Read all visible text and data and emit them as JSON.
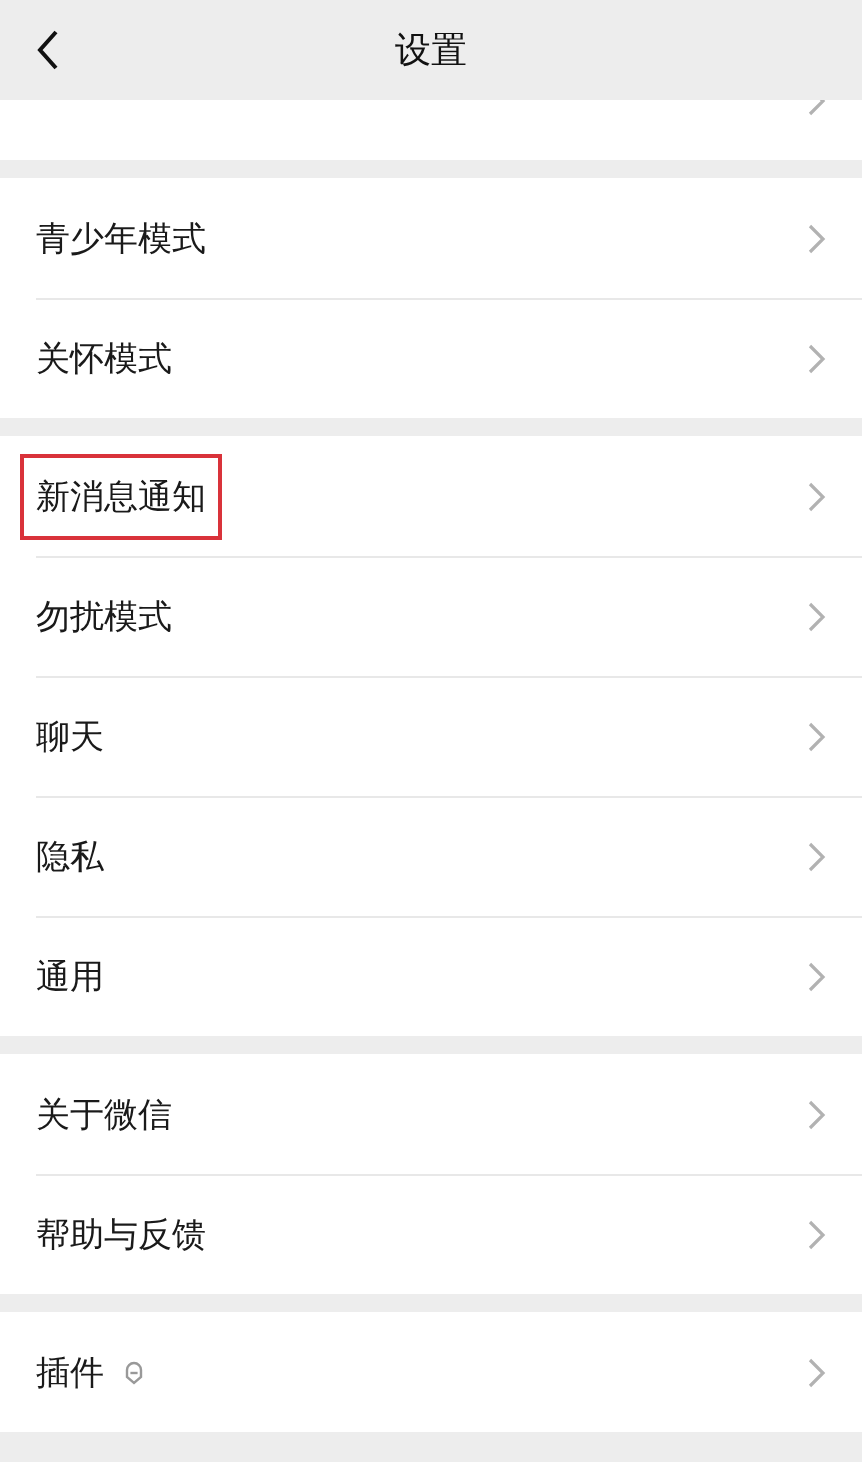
{
  "header": {
    "title": "设置"
  },
  "groups": [
    {
      "items": [
        {
          "kind": "cut-off"
        }
      ]
    },
    {
      "items": [
        {
          "label": "青少年模式",
          "highlighted": false
        },
        {
          "label": "关怀模式",
          "highlighted": false
        }
      ]
    },
    {
      "items": [
        {
          "label": "新消息通知",
          "highlighted": true
        },
        {
          "label": "勿扰模式",
          "highlighted": false
        },
        {
          "label": "聊天",
          "highlighted": false
        },
        {
          "label": "隐私",
          "highlighted": false
        },
        {
          "label": "通用",
          "highlighted": false
        }
      ]
    },
    {
      "items": [
        {
          "label": "关于微信",
          "highlighted": false
        },
        {
          "label": "帮助与反馈",
          "highlighted": false
        }
      ]
    },
    {
      "items": [
        {
          "label": "插件",
          "highlighted": false,
          "kind": "with-icon"
        }
      ]
    }
  ]
}
